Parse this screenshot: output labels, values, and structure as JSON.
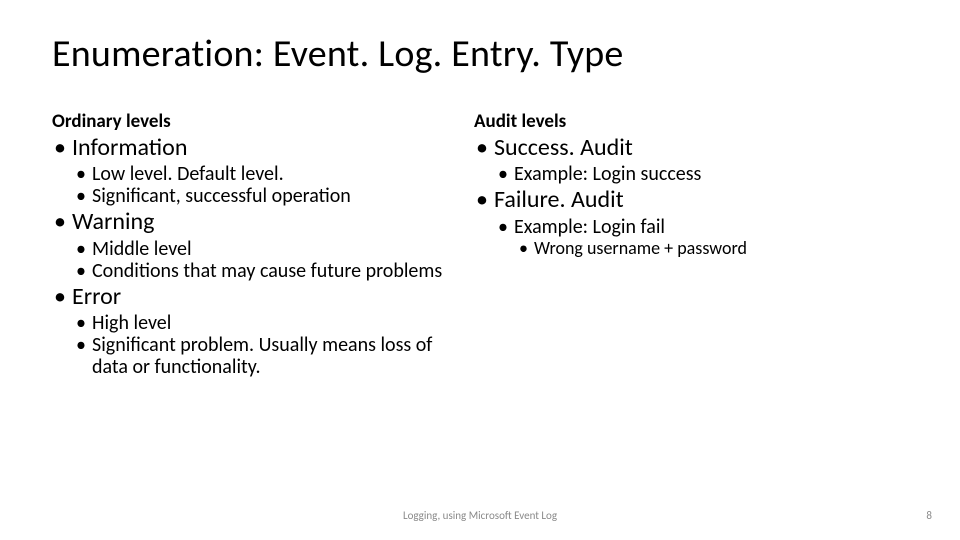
{
  "title": "Enumeration: Event. Log. Entry. Type",
  "left": {
    "heading": "Ordinary levels",
    "items": [
      {
        "label": "Information",
        "sub": [
          "Low level. Default level.",
          "Significant, successful operation"
        ]
      },
      {
        "label": "Warning",
        "sub": [
          "Middle level",
          "Conditions that may cause future problems"
        ]
      },
      {
        "label": "Error",
        "sub": [
          "High level",
          "Significant problem. Usually means loss of data or functionality."
        ]
      }
    ]
  },
  "right": {
    "heading": "Audit levels",
    "items": [
      {
        "label": "Success. Audit",
        "sub": [
          {
            "label": "Example: Login success",
            "sub": []
          }
        ]
      },
      {
        "label": "Failure. Audit",
        "sub": [
          {
            "label": "Example: Login fail",
            "sub": [
              "Wrong username + password"
            ]
          }
        ]
      }
    ]
  },
  "footer": {
    "center": "Logging, using Microsoft Event Log",
    "page": "8"
  }
}
